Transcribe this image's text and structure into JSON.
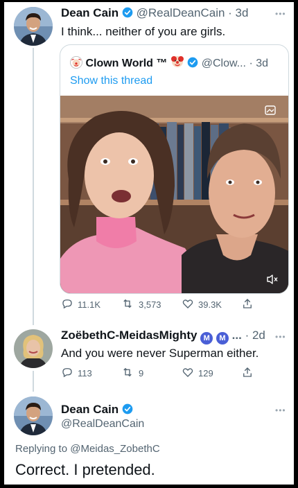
{
  "tweet1": {
    "name": "Dean Cain",
    "handle": "@RealDeanCain",
    "time": "· 3d",
    "text": "I think... neither of you are girls."
  },
  "quote": {
    "name": "Clown World ™",
    "handle": "@Clow...",
    "time": "· 3d",
    "show_thread": "Show this thread",
    "stats": {
      "replies": "11.1K",
      "retweets": "3,573",
      "likes": "39.3K"
    }
  },
  "tweet2": {
    "name": "ZoëbethC-MeidasMighty",
    "badge1": "M",
    "badge2": "M",
    "ellipsis": "...",
    "time": "· 2d",
    "text": "And you were never Superman either.",
    "stats": {
      "replies": "113",
      "retweets": "9",
      "likes": "129"
    }
  },
  "tweet3": {
    "name": "Dean Cain",
    "handle": "@RealDeanCain",
    "replying_prefix": "Replying to ",
    "replying_to": "@Meidas_ZobethC",
    "text": "Correct. I pretended."
  },
  "colors": {
    "accent": "#1d9bf0",
    "muted": "#536471",
    "border": "#cfd9de",
    "meidas": "#4a5fd6"
  },
  "icons": [
    "verified-badge-icon",
    "clown-icon",
    "reply-icon",
    "retweet-icon",
    "like-icon",
    "share-icon",
    "more-icon",
    "mute-icon",
    "media-icon"
  ]
}
